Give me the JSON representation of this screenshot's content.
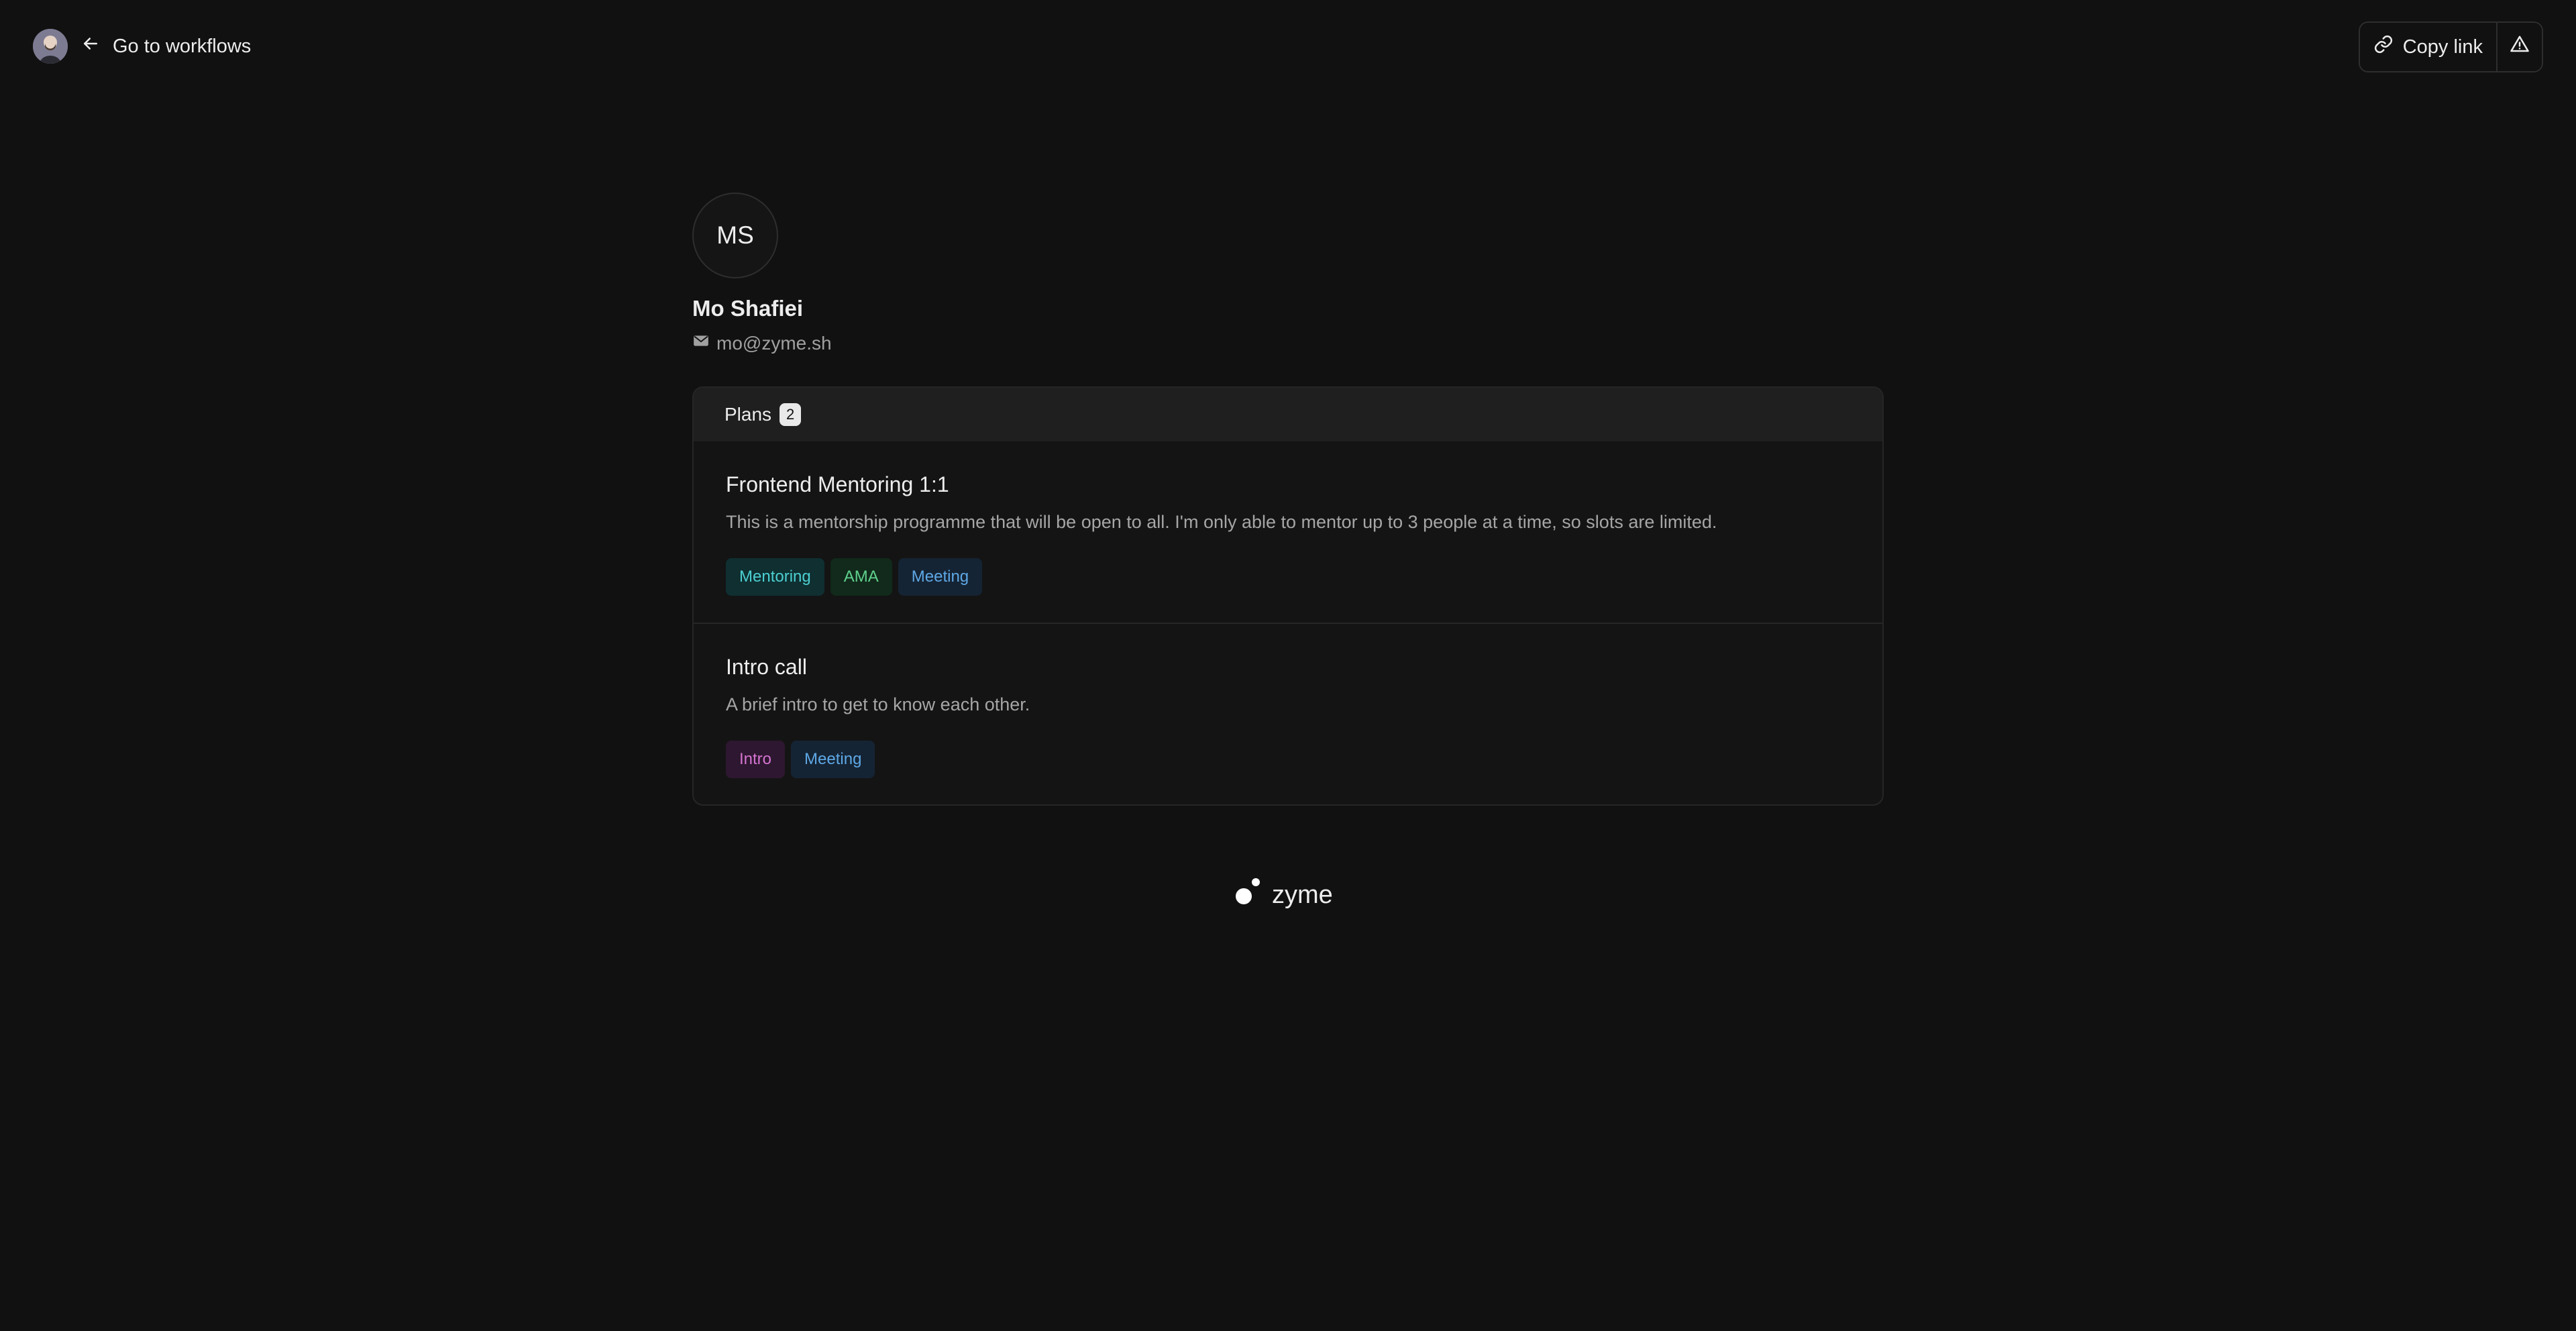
{
  "header": {
    "back_label": "Go to workflows",
    "copy_link_label": "Copy link"
  },
  "profile": {
    "initials": "MS",
    "name": "Mo Shafiei",
    "email": "mo@zyme.sh"
  },
  "plans": {
    "label": "Plans",
    "count": "2",
    "items": [
      {
        "title": "Frontend Mentoring 1:1",
        "description": "This is a mentorship programme that will be open to all. I'm only able to mentor up to 3 people at a time, so slots are limited.",
        "tags": [
          {
            "label": "Mentoring",
            "color": "#4ccfd1"
          },
          {
            "label": "AMA",
            "color": "#5fd18d"
          },
          {
            "label": "Meeting",
            "color": "#5ea8e6"
          }
        ]
      },
      {
        "title": "Intro call",
        "description": "A brief intro to get to know each other.",
        "tags": [
          {
            "label": "Intro",
            "color": "#d474d0"
          },
          {
            "label": "Meeting",
            "color": "#5ea8e6"
          }
        ]
      }
    ]
  },
  "footer": {
    "brand": "zyme"
  },
  "icons": [
    "user-avatar",
    "arrow-left-icon",
    "link-icon",
    "warning-icon",
    "mail-icon",
    "zyme-logo-icon"
  ]
}
